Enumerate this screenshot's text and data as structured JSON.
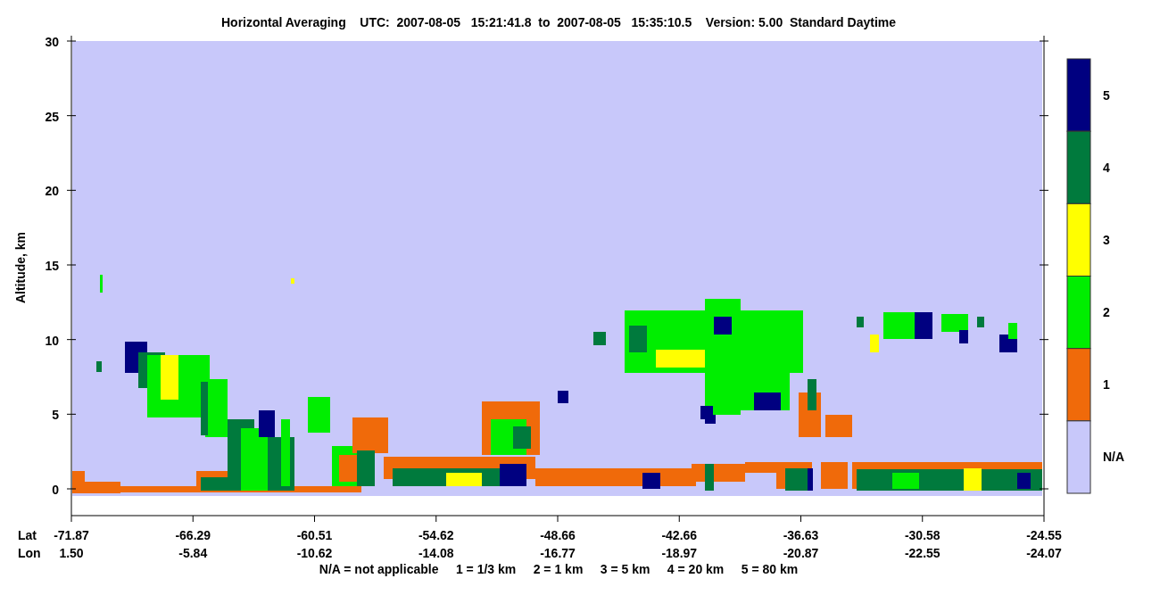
{
  "title": "Horizontal Averaging    UTC:  2007-08-05   15:21:41.8  to  2007-08-05   15:35:10.5    Version: 5.00  Standard Daytime",
  "y_axis": {
    "label": "Altitude, km",
    "ticks": [
      "30",
      "25",
      "20",
      "15",
      "10",
      "5",
      "0"
    ]
  },
  "x_axis": {
    "lat_label": "Lat",
    "lon_label": "Lon",
    "ticks": [
      {
        "lat": "-71.87",
        "lon": "1.50"
      },
      {
        "lat": "-66.29",
        "lon": "-5.84"
      },
      {
        "lat": "-60.51",
        "lon": "-10.62"
      },
      {
        "lat": "-54.62",
        "lon": "-14.08"
      },
      {
        "lat": "-48.66",
        "lon": "-16.77"
      },
      {
        "lat": "-42.66",
        "lon": "-18.97"
      },
      {
        "lat": "-36.63",
        "lon": "-20.87"
      },
      {
        "lat": "-30.58",
        "lon": "-22.55"
      },
      {
        "lat": "-24.55",
        "lon": "-24.07"
      }
    ]
  },
  "colorbar": [
    {
      "label": "5",
      "color": "#000080"
    },
    {
      "label": "4",
      "color": "#007a3d"
    },
    {
      "label": "3",
      "color": "#ffff00"
    },
    {
      "label": "2",
      "color": "#00ee00"
    },
    {
      "label": "1",
      "color": "#f06a0a"
    },
    {
      "label": "N/A",
      "color": "#c8c8fa"
    }
  ],
  "legend": "N/A = not applicable     1 = 1/3 km     2 = 1 km     3 = 5 km     4 = 20 km     5 = 80 km"
}
